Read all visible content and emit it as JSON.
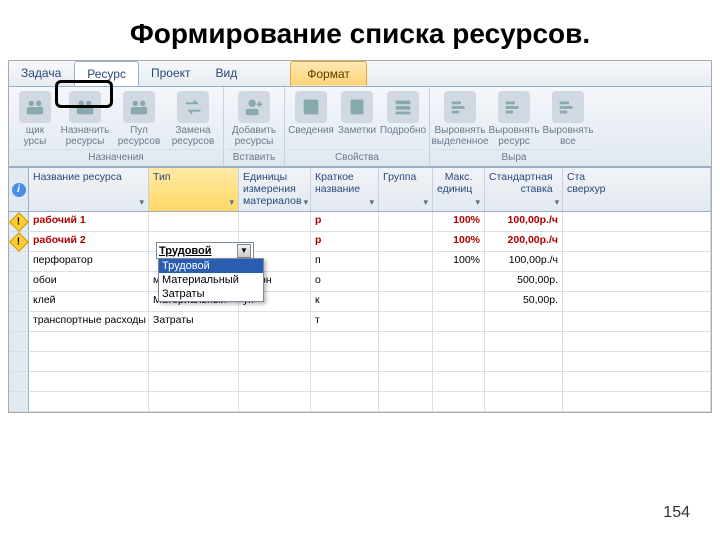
{
  "slide": {
    "title": "Формирование списка ресурсов.",
    "page_number": "154"
  },
  "tabs": {
    "task": "Задача",
    "resource": "Ресурс",
    "project": "Проект",
    "view": "Вид",
    "format": "Формат"
  },
  "ribbon": {
    "groups": {
      "assignments": {
        "label": "Назначения",
        "team_planner": "щик\nурсы",
        "assign": "Назначить\nресурсы",
        "pool": "Пул\nресурсов",
        "replace": "Замена\nресурсов"
      },
      "insert": {
        "label": "Вставить",
        "add": "Добавить\nресурсы"
      },
      "properties": {
        "label": "Свойства",
        "info": "Сведения",
        "notes": "Заметки",
        "details": "Подробно"
      },
      "level": {
        "label": "Выра",
        "level_sel": "Выровнять\nвыделенное",
        "level_res": "Выровнять\nресурс",
        "level_all": "Выровнять\nвсе"
      }
    }
  },
  "grid": {
    "headers": {
      "indicator": "",
      "name": "Название ресурса",
      "type": "Тип",
      "unit": "Единицы\nизмерения\nматериалов",
      "short": "Краткое\nназвание",
      "group": "Группа",
      "max": "Макс.\nединиц",
      "rate": "Стандартная\nставка",
      "over": "Ста\nсверхур"
    },
    "rows": [
      {
        "warn": true,
        "red": true,
        "name": "рабочий 1",
        "type": "",
        "unit": "",
        "short": "р",
        "group": "",
        "max": "100%",
        "rate": "100,00р./ч"
      },
      {
        "warn": true,
        "red": true,
        "name": "рабочий 2",
        "type": "",
        "unit": "",
        "short": "р",
        "group": "",
        "max": "100%",
        "rate": "200,00р./ч"
      },
      {
        "warn": false,
        "red": false,
        "name": "перфоратор",
        "type": "",
        "unit": "",
        "short": "п",
        "group": "",
        "max": "100%",
        "rate": "100,00р./ч"
      },
      {
        "warn": false,
        "red": false,
        "name": "обои",
        "type": "материальный",
        "unit": "рулон",
        "short": "о",
        "group": "",
        "max": "",
        "rate": "500,00р."
      },
      {
        "warn": false,
        "red": false,
        "name": "клей",
        "type": "Материальный",
        "unit": "уп",
        "short": "к",
        "group": "",
        "max": "",
        "rate": "50,00р."
      },
      {
        "warn": false,
        "red": false,
        "name": "транспортные расходы",
        "type": "Затраты",
        "unit": "",
        "short": "т",
        "group": "",
        "max": "",
        "rate": ""
      }
    ]
  },
  "dropdown": {
    "current": "Трудовой",
    "options": [
      "Трудовой",
      "Материальный",
      "Затраты"
    ]
  }
}
